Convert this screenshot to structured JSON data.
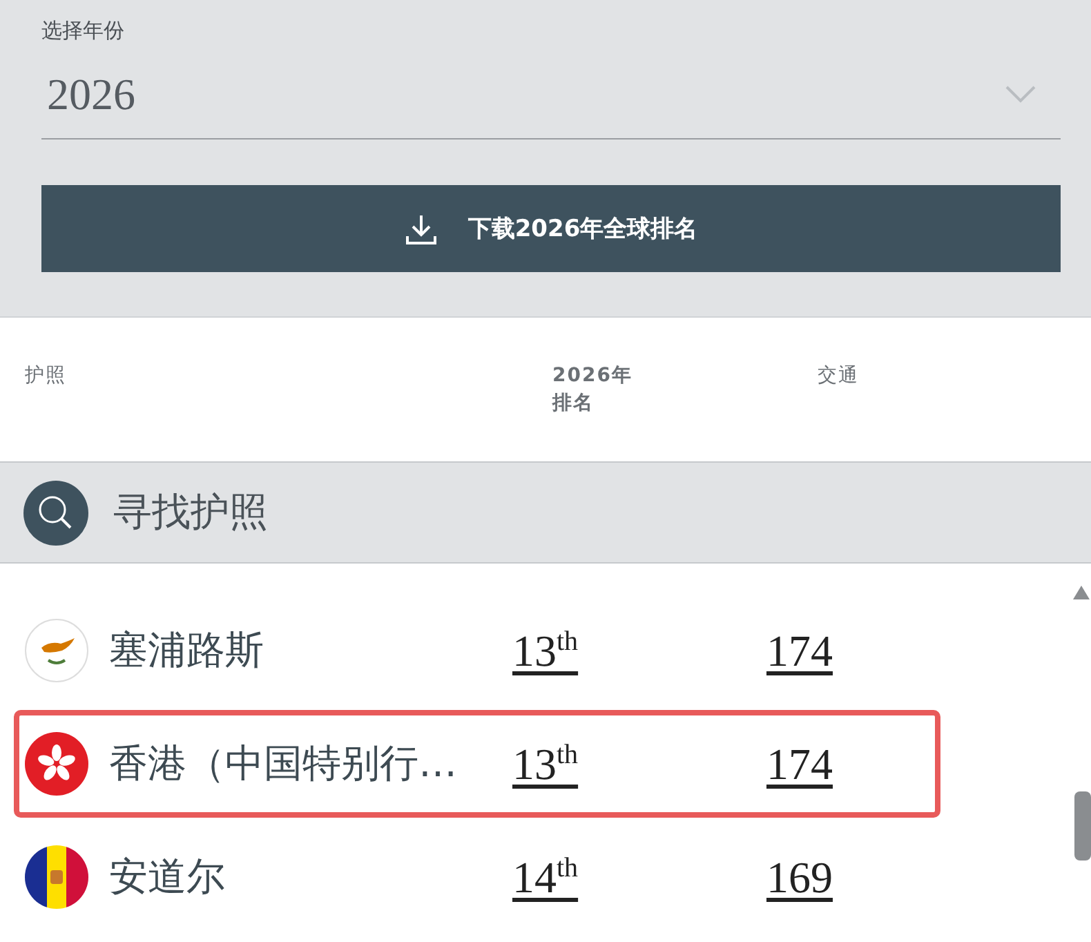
{
  "year_select": {
    "label": "选择年份",
    "value": "2026"
  },
  "download_button": {
    "label": "下载2026年全球排名"
  },
  "table": {
    "columns": [
      {
        "lines": [
          "护照"
        ]
      },
      {
        "lines": [
          "2026年",
          "排名"
        ]
      },
      {
        "lines": [
          "交通"
        ]
      }
    ],
    "search": {
      "placeholder": "寻找护照"
    },
    "rows": [
      {
        "kind": "cyprus",
        "name": "塞浦路斯",
        "rank": "13$^{th}$",
        "transport": "174",
        "highlighted": false
      },
      {
        "kind": "hongkong",
        "name": "香港（中国特别行…",
        "rank": "13$^{th}$",
        "transport": "174",
        "highlighted": true
      },
      {
        "kind": "andorra",
        "name": "安道尔",
        "rank": "14$^{th}$",
        "transport": "169",
        "highlighted": false
      }
    ]
  }
}
